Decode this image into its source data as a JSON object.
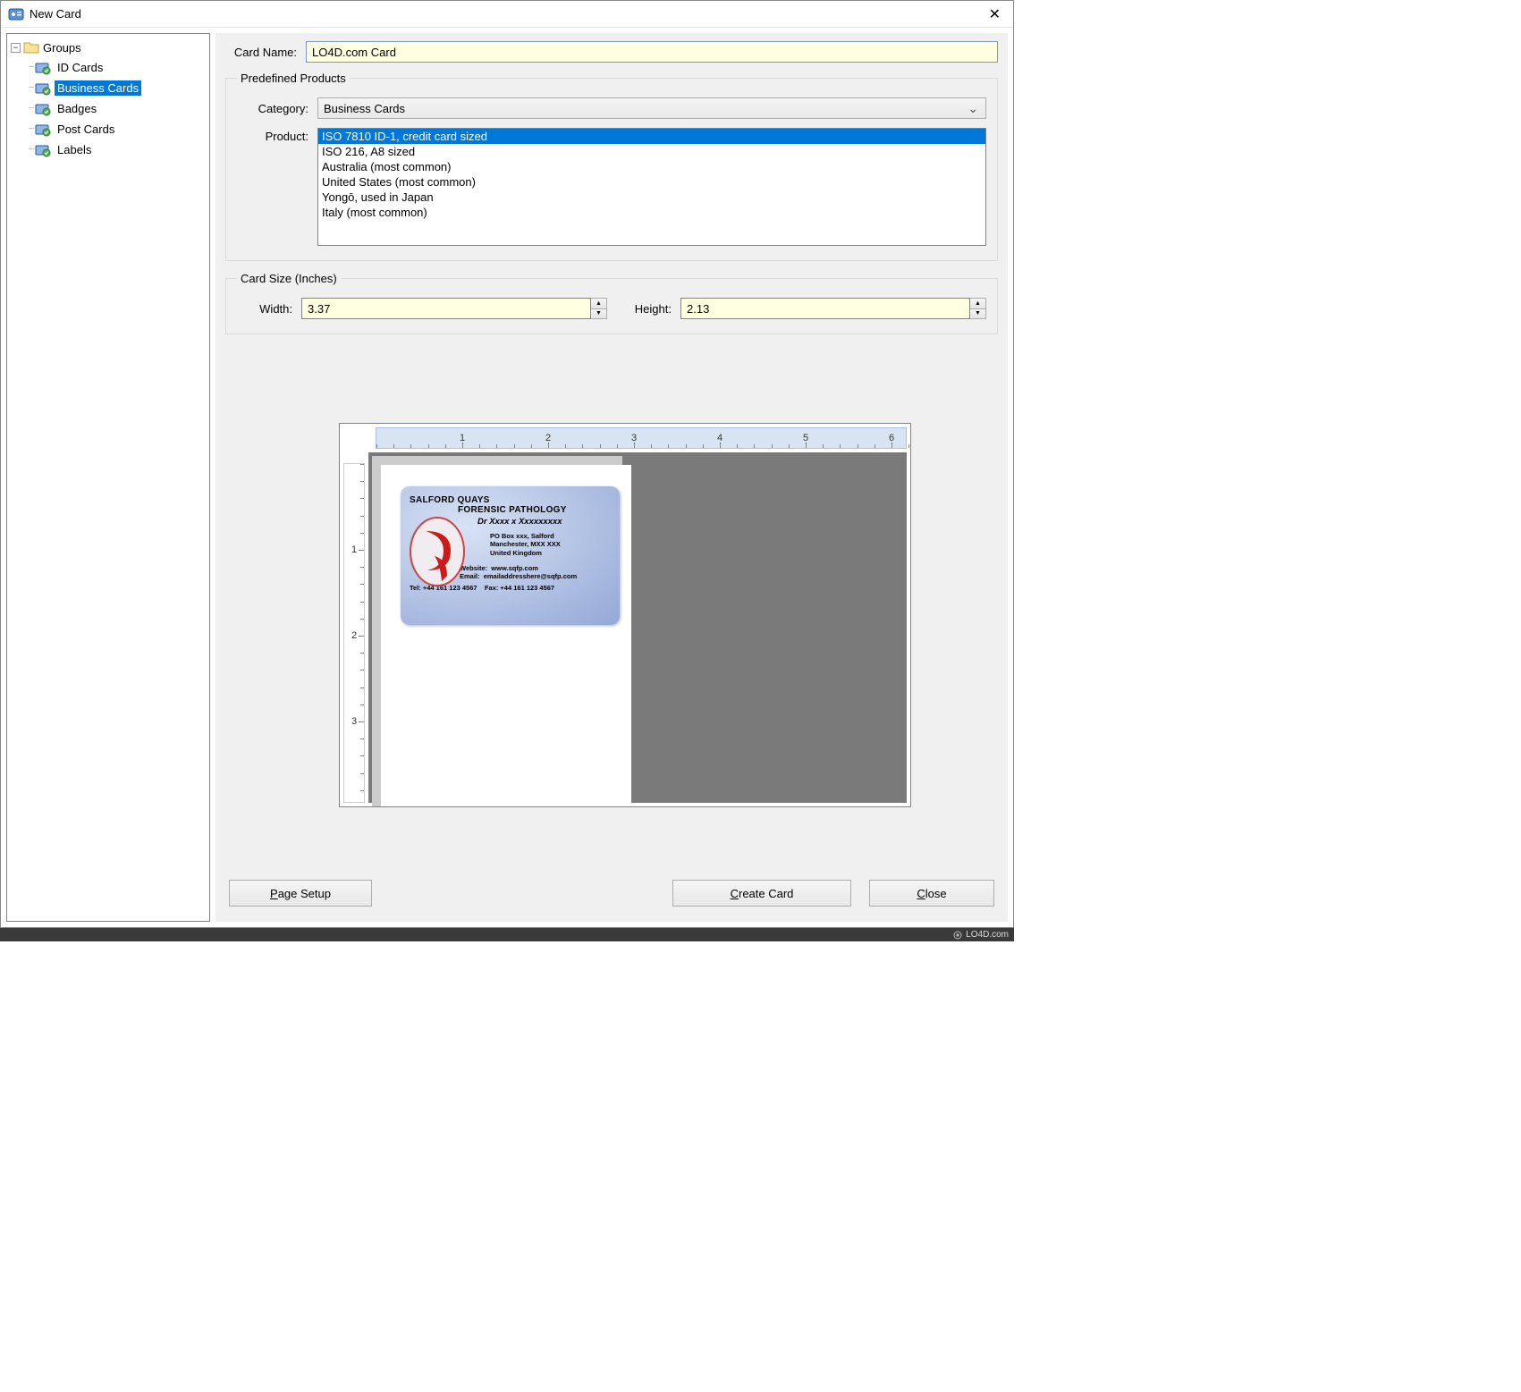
{
  "window": {
    "title": "New Card"
  },
  "tree": {
    "root_label": "Groups",
    "items": [
      {
        "label": "ID Cards",
        "selected": false
      },
      {
        "label": "Business Cards",
        "selected": true
      },
      {
        "label": "Badges",
        "selected": false
      },
      {
        "label": "Post Cards",
        "selected": false
      },
      {
        "label": "Labels",
        "selected": false
      }
    ]
  },
  "form": {
    "card_name_label": "Card Name:",
    "card_name_value": "LO4D.com Card",
    "predefined_legend": "Predefined Products",
    "category_label": "Category:",
    "category_value": "Business Cards",
    "product_label": "Product:",
    "products": [
      "ISO 7810 ID-1, credit card sized",
      "ISO 216, A8 sized",
      "Australia (most common)",
      "United States (most common)",
      "Yongō, used in Japan",
      "Italy (most common)"
    ],
    "product_selected_index": 0,
    "size_legend": "Card Size (Inches)",
    "width_label": "Width:",
    "width_value": "3.37",
    "height_label": "Height:",
    "height_value": "2.13"
  },
  "ruler": {
    "h": [
      "1",
      "2",
      "3",
      "4",
      "5",
      "6"
    ],
    "v": [
      "1",
      "2",
      "3"
    ]
  },
  "preview_card": {
    "line1": "SALFORD QUAYS",
    "line2": "FORENSIC PATHOLOGY",
    "line3": "Dr Xxxx x Xxxxxxxxx",
    "addr1": "PO Box xxx, Salford",
    "addr2": "Manchester, MXX XXX",
    "addr3": "United Kingdom",
    "web_k": "Website:",
    "web_v": "www.sqfp.com",
    "email_k": "Email:",
    "email_v": "emailaddresshere@sqfp.com",
    "tel_k": "Tel:",
    "tel_v": "+44 161 123 4567",
    "fax_k": "Fax:",
    "fax_v": "+44 161 123 4567"
  },
  "buttons": {
    "page_setup": "Page Setup",
    "create": "Create Card",
    "close": "Close"
  },
  "footer": {
    "text": "LO4D.com"
  }
}
